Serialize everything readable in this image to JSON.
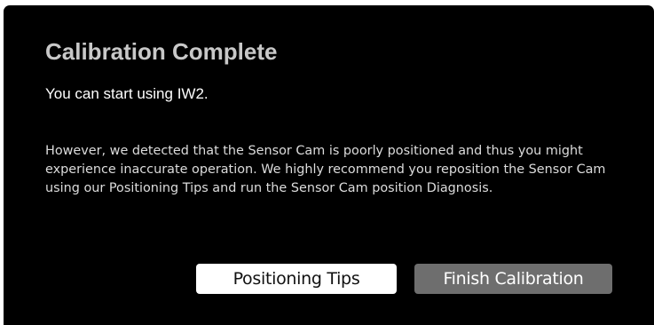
{
  "dialog": {
    "title": "Calibration Complete",
    "subtitle": "You can start using IW2.",
    "warning": "However, we detected that the Sensor Cam is poorly positioned and thus you might experience inaccurate operation. We highly recommend you reposition the Sensor Cam using our Positioning Tips and run the Sensor Cam position Diagnosis.",
    "buttons": {
      "positioning_tips": "Positioning Tips",
      "finish_calibration": "Finish Calibration"
    }
  },
  "colors": {
    "background": "#000000",
    "title": "#c8c8c8",
    "primary_button": "#ffffff",
    "secondary_button": "#6e6e6e"
  }
}
